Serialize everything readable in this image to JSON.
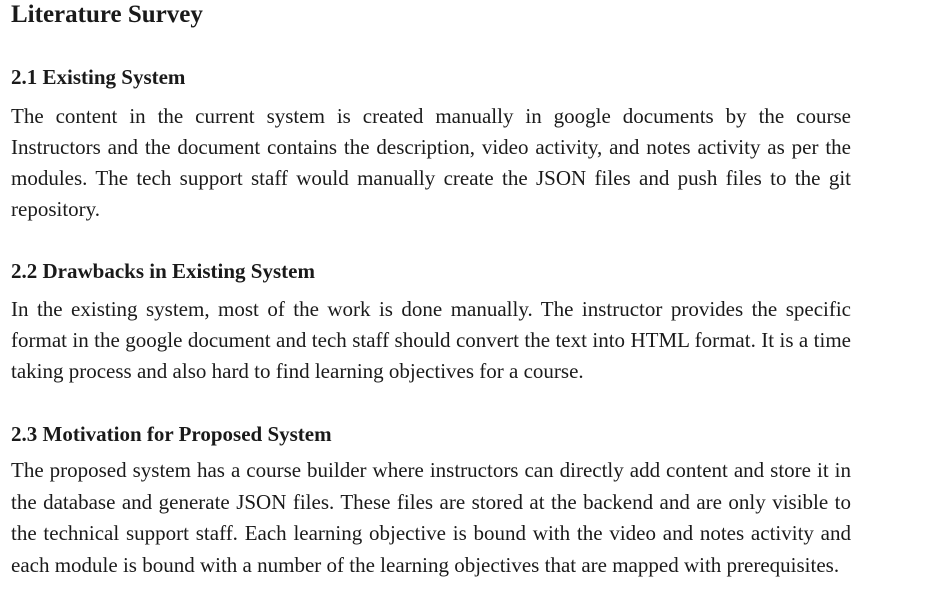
{
  "document": {
    "title": "Literature Survey",
    "sections": [
      {
        "heading": "2.1 Existing System",
        "body": "The content in the current system is created manually in google documents by the course Instructors and the document contains the description, video activity, and notes activity as per the modules. The tech support staff would manually create the JSON files and push files to the git repository."
      },
      {
        "heading": "2.2 Drawbacks in Existing System",
        "body": "In the existing system, most of the work is done manually. The instructor provides the specific format in the google document and tech staff should convert the text into HTML format. It is a time taking process and also hard to find learning objectives for a course."
      },
      {
        "heading": "2.3 Motivation for Proposed System",
        "body": "The proposed system has a course builder where instructors can directly add content and store it in the database and generate JSON files. These files are stored at the backend and are only visible to the technical support staff. Each learning objective is bound with the video and notes activity and each module is bound with a number of the learning objectives that are mapped with prerequisites."
      }
    ]
  }
}
